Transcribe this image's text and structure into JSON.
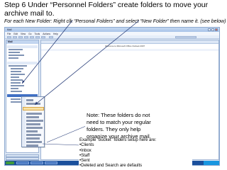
{
  "slide": {
    "title": "Step 6  Under “Personnel Folders” create folders to move your archive mail to.",
    "subtitle": "For each New Folder: Right clk “Personal Folders” and select “New Folder” then name it. (see below)"
  },
  "note": {
    "text": "Note: These folders do not need to match your regular folders.  They only help organize your archive mail."
  },
  "bucket": {
    "intro": "Example “bucket” folders setup here are:",
    "items": [
      "Clients",
      "Inbox",
      "Staff",
      "Sent",
      "Deleted and Search are defaults"
    ]
  },
  "screenshot": {
    "window_title": "Mail",
    "menus": [
      "File",
      "Edit",
      "View",
      "Go",
      "Tools",
      "Actions",
      "Help"
    ],
    "nav_header": "Mail",
    "welcome": "Welcome to Microsoft Office Outlook 2007"
  },
  "colors": {
    "arrow": "#2a3f7a",
    "highlight": "#f8e2a6",
    "taskbar": "#1a4f9c"
  }
}
